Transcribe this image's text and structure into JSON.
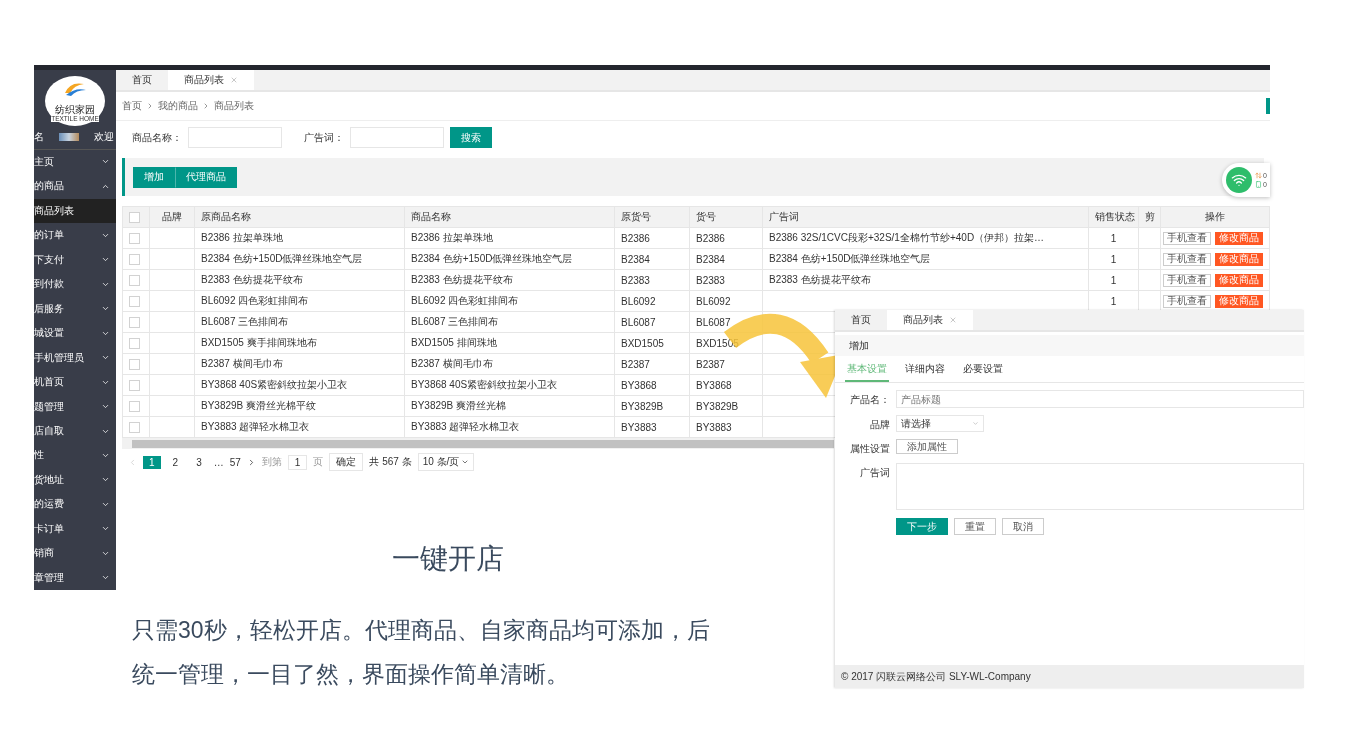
{
  "sidebar": {
    "logo_title": "纺织家园",
    "logo_subtitle": "TEXTILE HOME",
    "user_label": "名",
    "welcome": "欢迎",
    "items": [
      {
        "label": "主页",
        "expanded": false
      },
      {
        "label": "的商品",
        "expanded": true,
        "children": [
          {
            "label": "商品列表",
            "selected": true
          }
        ]
      },
      {
        "label": "的订单",
        "expanded": false
      },
      {
        "label": "下支付",
        "expanded": false
      },
      {
        "label": "到付款",
        "expanded": false
      },
      {
        "label": "后服务",
        "expanded": false
      },
      {
        "label": "城设置",
        "expanded": false
      },
      {
        "label": "手机管理员",
        "expanded": false
      },
      {
        "label": "机首页",
        "expanded": false
      },
      {
        "label": "题管理",
        "expanded": false
      },
      {
        "label": "店自取",
        "expanded": false
      },
      {
        "label": "性",
        "expanded": false
      },
      {
        "label": "货地址",
        "expanded": false
      },
      {
        "label": "的运费",
        "expanded": false
      },
      {
        "label": "卡订单",
        "expanded": false
      },
      {
        "label": "销商",
        "expanded": false
      },
      {
        "label": "章管理",
        "expanded": false
      }
    ]
  },
  "tabs": [
    {
      "label": "首页",
      "selected": false,
      "closable": false
    },
    {
      "label": "商品列表",
      "selected": true,
      "closable": true
    }
  ],
  "breadcrumb": [
    "首页",
    "我的商品",
    "商品列表"
  ],
  "search": {
    "fields": [
      "商品名称：",
      "广告词："
    ],
    "button": "搜索"
  },
  "toolbar": [
    "增加",
    "代理商品"
  ],
  "status_widget": {
    "values": [
      "0",
      "0"
    ]
  },
  "table": {
    "header_checked": false,
    "columns": [
      "品牌",
      "原商品名称",
      "商品名称",
      "原货号",
      "货号",
      "广告词",
      "销售状态",
      "剪",
      "操作"
    ],
    "rows": [
      {
        "checked": false,
        "original_name": "B2386 拉架单珠地",
        "name": "B2386 拉架单珠地",
        "original_code": "B2386",
        "code": "B2386",
        "ad": "B2386 32S/1CVC段彩+32S/1全棉竹节纱+40D（伊邦）拉架…",
        "status": "1",
        "actions": [
          "手机查看",
          "修改商品"
        ]
      },
      {
        "checked": false,
        "original_name": "B2384 色纺+150D低弹丝珠地空气层",
        "name": "B2384 色纺+150D低弹丝珠地空气层",
        "original_code": "B2384",
        "code": "B2384",
        "ad": "B2384 色纺+150D低弹丝珠地空气层",
        "status": "1",
        "actions": [
          "手机查看",
          "修改商品"
        ]
      },
      {
        "checked": false,
        "original_name": "B2383 色纺提花平纹布",
        "name": "B2383 色纺提花平纹布",
        "original_code": "B2383",
        "code": "B2383",
        "ad": "B2383 色纺提花平纹布",
        "status": "1",
        "actions": [
          "手机查看",
          "修改商品"
        ]
      },
      {
        "checked": false,
        "original_name": "BL6092 四色彩虹排间布",
        "name": "BL6092 四色彩虹排间布",
        "original_code": "BL6092",
        "code": "BL6092",
        "status": "1",
        "actions": [
          "手机查看",
          "修改商品"
        ]
      },
      {
        "checked": false,
        "original_name": "BL6087 三色排间布",
        "name": "BL6087 三色排间布",
        "original_code": "BL6087",
        "code": "BL6087"
      },
      {
        "checked": false,
        "original_name": "BXD1505 爽手排间珠地布",
        "name": "BXD1505 排间珠地",
        "original_code": "BXD1505",
        "code": "BXD1505"
      },
      {
        "checked": false,
        "original_name": "B2387 横间毛巾布",
        "name": "B2387 横间毛巾布",
        "original_code": "B2387",
        "code": "B2387"
      },
      {
        "checked": false,
        "original_name": "BY3868 40S紧密斜纹拉架小卫衣",
        "name": "BY3868 40S紧密斜纹拉架小卫衣",
        "original_code": "BY3868",
        "code": "BY3868"
      },
      {
        "checked": false,
        "original_name": "BY3829B 爽滑丝光棉平纹",
        "name": "BY3829B 爽滑丝光棉",
        "original_code": "BY3829B",
        "code": "BY3829B"
      },
      {
        "checked": false,
        "original_name": "BY3883 超弹轻水棉卫衣",
        "name": "BY3883 超弹轻水棉卫衣",
        "original_code": "BY3883",
        "code": "BY3883"
      }
    ]
  },
  "pagination": {
    "pages": [
      {
        "label": "1",
        "selected": true
      },
      {
        "label": "2",
        "selected": false
      },
      {
        "label": "3",
        "selected": false
      }
    ],
    "ellipsis": "…",
    "last": "57",
    "goto_label": "到第",
    "goto_value": "1",
    "page_unit": "页",
    "confirm": "确定",
    "total": "共 567 条",
    "page_size": "10 条/页"
  },
  "form_window": {
    "tabs": [
      {
        "label": "首页",
        "selected": false,
        "closable": false
      },
      {
        "label": "商品列表",
        "selected": true,
        "closable": true
      }
    ],
    "toolbar": "增加",
    "form_tabs": [
      {
        "label": "基本设置",
        "selected": true
      },
      {
        "label": "详细内容",
        "selected": false
      },
      {
        "label": "必要设置",
        "selected": false
      }
    ],
    "fields": [
      {
        "kind": "text",
        "label": "产品名：",
        "placeholder": "产品标题"
      },
      {
        "kind": "select",
        "label": "品牌",
        "value": "请选择"
      },
      {
        "kind": "button",
        "label": "属性设置",
        "button": "添加属性"
      },
      {
        "kind": "textarea",
        "label": "广告词"
      }
    ],
    "buttons": [
      {
        "label": "下一步",
        "primary": true
      },
      {
        "label": "重置",
        "primary": false
      },
      {
        "label": "取消",
        "primary": false
      }
    ],
    "footer": "© 2017 闪联云网络公司 SLY-WL-Company"
  },
  "heading": "一键开店",
  "description": "只需30秒，轻松开店。代理商品、自家商品均可添加，后统一管理，一目了然，界面操作简单清晰。"
}
